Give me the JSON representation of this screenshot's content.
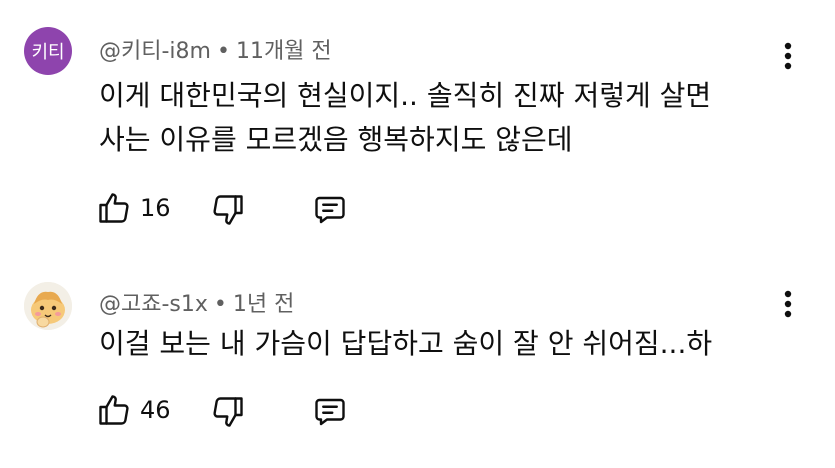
{
  "comments": [
    {
      "avatar_text": "키티",
      "avatar_color": "#8e44ad",
      "author": "@키티-i8m",
      "separator": "•",
      "time": "11개월 전",
      "lines": [
        "이게 대한민국의 현실이지.. 솔직히 진짜 저렇게 살면",
        "사는 이유를 모르겠음 행복하지도 않은데"
      ],
      "likes": "16",
      "icons": [
        "thumbs-up-icon",
        "thumbs-down-icon",
        "reply-icon",
        "more-vert-icon"
      ]
    },
    {
      "avatar_kind": "cartoon-character",
      "author": "@고죠-s1x",
      "separator": "•",
      "time": "1년 전",
      "lines": [
        "이걸 보는 내 가슴이 답답하고 숨이 잘 안 쉬어짐...하"
      ],
      "likes": "46",
      "icons": [
        "thumbs-up-icon",
        "thumbs-down-icon",
        "reply-icon",
        "more-vert-icon"
      ]
    }
  ]
}
